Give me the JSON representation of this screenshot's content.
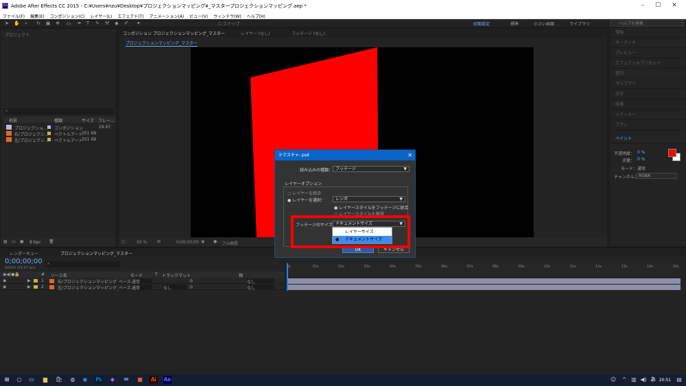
{
  "window": {
    "title": "Adobe After Effects CC 2015 - C:¥Users¥nzu¥Desktop¥プロジェクションマッピング¥_マスタープロジェクションマッピング.aep *"
  },
  "menu": [
    "ファイル(F)",
    "編集(E)",
    "コンポジション(C)",
    "レイヤー(L)",
    "エフェクト(T)",
    "アニメーション(A)",
    "ビュー(V)",
    "ウィンドウ(W)",
    "ヘルプ(H)"
  ],
  "toolbar": {
    "snap": "スナップ",
    "workspaces": [
      "初期設定",
      "標準",
      "小さい画面",
      "ライブラリ"
    ],
    "help_search_placeholder": "ヘルプを検索"
  },
  "project": {
    "tab": "プロジェクト",
    "columns": [
      "名前",
      "種類",
      "サイズ",
      "フレー..."
    ],
    "rows": [
      {
        "name": "プロジェクショ...",
        "type": "コンポジション",
        "size": "",
        "fps": "29.97"
      },
      {
        "name": "右/プロジェクシ...",
        "type": "ベクトルアート",
        "size": "351 KB",
        "fps": ""
      },
      {
        "name": "左/プロジェクシ...",
        "type": "ベクトルアート",
        "size": "351 KB",
        "fps": ""
      }
    ],
    "bpc": "8 bpc"
  },
  "comp": {
    "tabs": [
      "コンポジション プロジェクションマッピング_マスター",
      "レイヤー (なし)",
      "フッテージ (なし)"
    ],
    "subtab": "プロジェクションマッピング_マスター",
    "zoom": "50 %",
    "timecode": "0;00;00;00",
    "quality": "フル画質"
  },
  "right_panels": [
    "情報",
    "オーディオ",
    "プレビュー",
    "エフェクト＆プリセット",
    "整列",
    "ライブラリ",
    "文字",
    "段落",
    "トラッカー",
    "ブラシ",
    "ペイント"
  ],
  "paint": {
    "opacity_label": "不透明度：",
    "opacity_value": "0 %",
    "flow_label": "流量：",
    "flow_value": "0 %",
    "mode_label": "モード：",
    "mode_value": "通常",
    "channel_label": "チャンネル：",
    "channel_value": "RGBA",
    "fg_color": "#ff0000",
    "bg_color": "#ffffff"
  },
  "timeline": {
    "tabs": [
      "レンダーキュー",
      "プロジェクションマッピング_マスター"
    ],
    "time": "0;00;00;00",
    "fps": "00000 (29.97 fps)",
    "columns": [
      "#",
      "ソース名",
      "モード",
      "T",
      "トラックマット",
      "親"
    ],
    "layers": [
      {
        "num": "1",
        "name": "右/プロジェクションマッピング_ベース.ai",
        "mode": "通常",
        "track": "",
        "parent": "なし"
      },
      {
        "num": "2",
        "name": "左/プロジェクションマッピング_ベース.ai",
        "mode": "通常",
        "track": "なし",
        "parent": "なし"
      }
    ],
    "ruler": [
      "0s",
      "01s",
      "02s",
      "03s",
      "04s",
      "05s",
      "06s",
      "07s",
      "08s",
      "09s",
      "10s",
      "11s",
      "12s",
      "13s",
      "14s",
      "15s"
    ]
  },
  "dialog": {
    "title": "テクスチャ-.psd",
    "import_kind_label": "読み込みの種類：",
    "import_kind_value": "フッテージ",
    "layer_options_label": "レイヤーオプション",
    "merge_layers": "レイヤーを統合",
    "choose_layer": "レイヤーを選択：",
    "choose_layer_value": "レンガ",
    "merge_styles": "レイヤースタイルをフッテージに統合",
    "ignore_styles": "レイヤースタイルを無視",
    "footage_size_label": "フッテージのサイズ：",
    "footage_size_value": "ドキュメントサイズ",
    "dropdown_options": [
      "レイヤーサイズ",
      "ドキュメントサイズ"
    ],
    "ok": "OK",
    "cancel": "キャンセル"
  },
  "taskbar": {
    "ime": "あ",
    "clock": "20:51"
  }
}
